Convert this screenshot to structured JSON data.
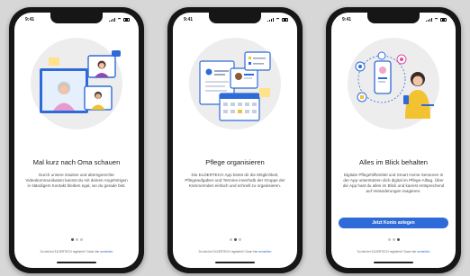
{
  "status_bar": {
    "time": "9:41"
  },
  "screens": [
    {
      "title": "Mal kurz nach Oma schauen",
      "description": "Durch unsere intuitive und altersgerechte Videokommunikation kannst du mit deinen Angehörigen in ständigem Kontakt bleiben egal, wo du gerade bist.",
      "active_dot": 0,
      "footer_text": "Du bist bei ELDERTECH registriert? Dann hier",
      "footer_link": "anmelden"
    },
    {
      "title": "Pflege organisieren",
      "description": "Die ELDERTECH App bietet dir die Möglichkeit, Pflegeaufgaben und Termine innerhalb der Gruppe der Kümmernden einfach und schnell zu organisieren.",
      "active_dot": 1,
      "footer_text": "Du bist bei ELDERTECH registriert? Dann hier",
      "footer_link": "anmelden"
    },
    {
      "title": "Alles im Blick behalten",
      "description": "Digitale Pflegehilfsmittel und Smart Home Sensoren in der App unterstützen dich digital im Pflege-Alltag. Über die App hast du alles im Blick und kannst entsprechend auf Veränderungen reagieren.",
      "button_label": "Jetzt Konto anlegen",
      "active_dot": 2,
      "footer_text": "Du bist bei ELDERTECH registriert? Dann hier",
      "footer_link": "anmelden"
    }
  ],
  "colors": {
    "accent": "#2f6bd8",
    "illustration_bg": "#ededee",
    "screen_bg": "#ffffff"
  }
}
